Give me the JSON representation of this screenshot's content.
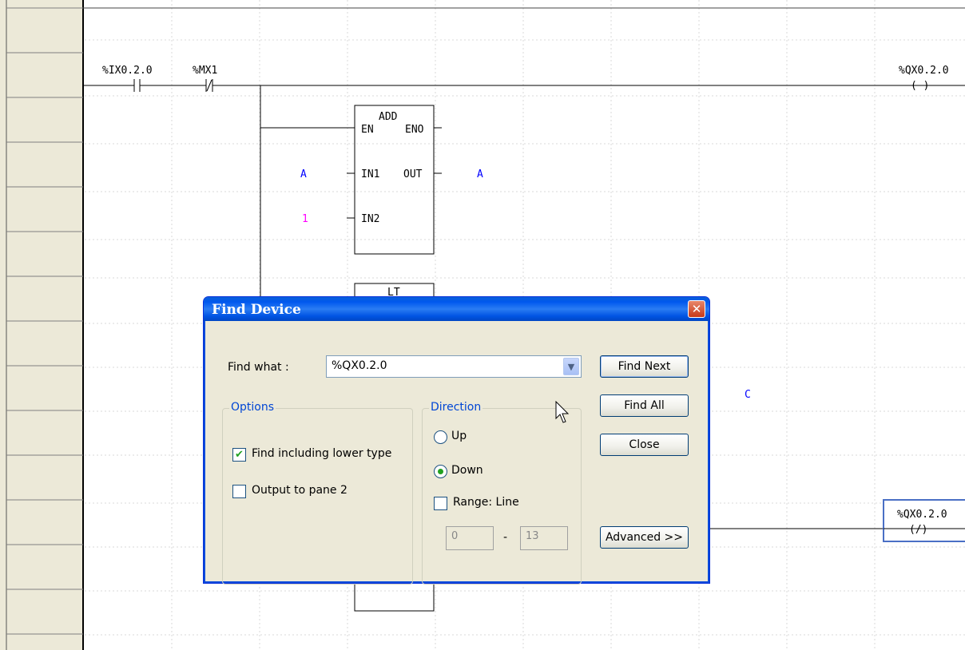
{
  "ladder": {
    "contact1_label": "%IX0.2.0",
    "contact2_label": "%MX1",
    "coil1_label": "%QX0.2.0",
    "coil1_symbol": "( )",
    "coil2_label": "%QX0.2.0",
    "coil2_symbol": "(/)",
    "add_block": {
      "name": "ADD",
      "pin_en": "EN",
      "pin_eno": "ENO",
      "pin_in1": "IN1",
      "pin_out": "OUT",
      "pin_in2": "IN2",
      "in1_var": "A",
      "out_var": "A",
      "in2_const": "1"
    },
    "lt_block_name": "LT",
    "var_c": "C",
    "colors": {
      "variable": "#0000ff",
      "constant": "#ff00ff",
      "rail_bg": "#ece9d8",
      "selection": "#4a6fc5"
    }
  },
  "dialog": {
    "title": "Find Device",
    "find_what_label": "Find what :",
    "find_what_value": "%QX0.2.0",
    "options": {
      "title": "Options",
      "find_lower_type": "Find including lower type",
      "find_lower_type_checked": true,
      "output_pane2": "Output to pane 2",
      "output_pane2_checked": false
    },
    "direction": {
      "title": "Direction",
      "up": "Up",
      "down": "Down",
      "selected": "Down",
      "range_label": "Range: Line",
      "range_checked": false,
      "range_from": "0",
      "range_sep": "-",
      "range_to": "13"
    },
    "buttons": {
      "find_next": "Find Next",
      "find_all": "Find All",
      "close": "Close",
      "advanced": "Advanced >>"
    }
  }
}
